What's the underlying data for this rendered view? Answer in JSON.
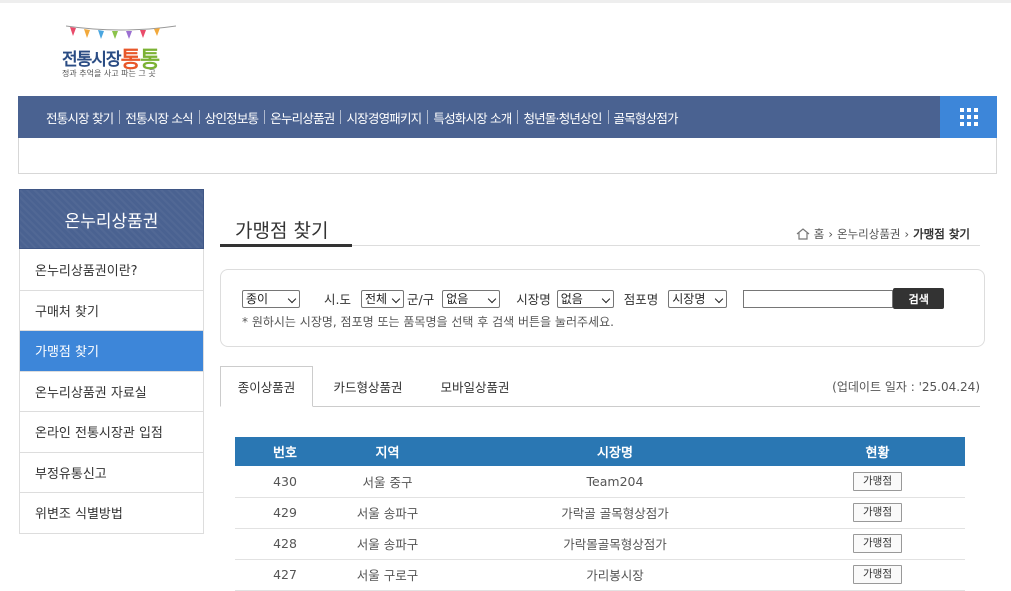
{
  "logo": {
    "title_a": "전통시장",
    "title_b": "통",
    "title_c": "통",
    "subtitle": "정과 추억을 사고 파는 그 곳"
  },
  "nav": {
    "items": [
      "전통시장 찾기",
      "전통시장 소식",
      "상인정보통",
      "온누리상품권",
      "시장경영패키지",
      "특성화시장 소개",
      "청년몰·청년상인",
      "골목형상점가"
    ]
  },
  "sidebar": {
    "title": "온누리상품권",
    "items": [
      "온누리상품권이란?",
      "구매처 찾기",
      "가맹점 찾기",
      "온누리상품권 자료실",
      "온라인 전통시장관 입점",
      "부정유통신고",
      "위변조 식별방법"
    ],
    "active_index": 2
  },
  "page": {
    "title": "가맹점 찾기",
    "breadcrumb": [
      "홈",
      "온누리상품권",
      "가맹점 찾기"
    ]
  },
  "search": {
    "type_value": "종이",
    "sido_label": "시.도",
    "sido_value": "전체",
    "gungu_label": "군/구",
    "gungu_value": "없음",
    "market_label": "시장명",
    "market_value": "없음",
    "store_label": "점포명",
    "field_value": "시장명",
    "button": "검색",
    "hint": "* 원하시는 시장명, 점포명 또는 품목명을 선택 후 검색 버튼을 눌러주세요."
  },
  "tabs": {
    "items": [
      "종이상품권",
      "카드형상품권",
      "모바일상품권"
    ],
    "update": "(업데이트 일자 : '25.04.24)"
  },
  "table": {
    "headers": [
      "번호",
      "지역",
      "시장명",
      "현황"
    ],
    "button_label": "가맹점",
    "rows": [
      {
        "no": "430",
        "region": "서울 중구",
        "market": "Team204"
      },
      {
        "no": "429",
        "region": "서울 송파구",
        "market": "가락골 골목형상점가"
      },
      {
        "no": "428",
        "region": "서울 송파구",
        "market": "가락몰골목형상점가"
      },
      {
        "no": "427",
        "region": "서울 구로구",
        "market": "가리봉시장"
      }
    ]
  },
  "colors": {
    "nav_bg": "#4a6291",
    "accent_blue": "#3d86d9",
    "table_header": "#2a77b3"
  }
}
